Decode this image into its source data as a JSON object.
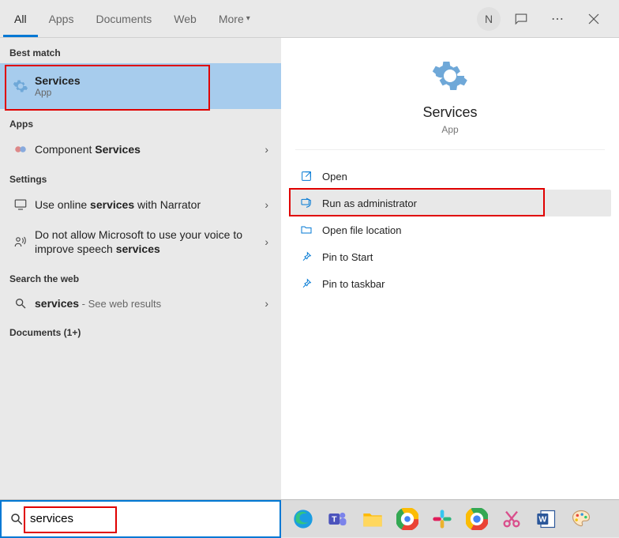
{
  "tabs": {
    "all": "All",
    "apps": "Apps",
    "documents": "Documents",
    "web": "Web",
    "more": "More"
  },
  "user_initial": "N",
  "sections": {
    "best_match": "Best match",
    "apps": "Apps",
    "settings": "Settings",
    "search_web": "Search the web",
    "documents": "Documents (1+)"
  },
  "results": {
    "services": {
      "title_prefix": "",
      "title_bold": "Services",
      "title_suffix": "",
      "sub": "App"
    },
    "component_services": {
      "title_prefix": "Component ",
      "title_bold": "Services",
      "title_suffix": ""
    },
    "narrator": {
      "title_prefix": "Use online ",
      "title_bold": "services",
      "title_suffix": " with Narrator"
    },
    "speech": {
      "title_prefix": "Do not allow Microsoft to use your voice to improve speech ",
      "title_bold": "services",
      "title_suffix": ""
    },
    "web": {
      "title_prefix": "",
      "title_bold": "services",
      "title_suffix": "",
      "sub": " - See web results"
    }
  },
  "detail": {
    "title": "Services",
    "sub": "App"
  },
  "actions": {
    "open": "Open",
    "run_admin": "Run as administrator",
    "open_location": "Open file location",
    "pin_start": "Pin to Start",
    "pin_taskbar": "Pin to taskbar"
  },
  "search_value": "services"
}
